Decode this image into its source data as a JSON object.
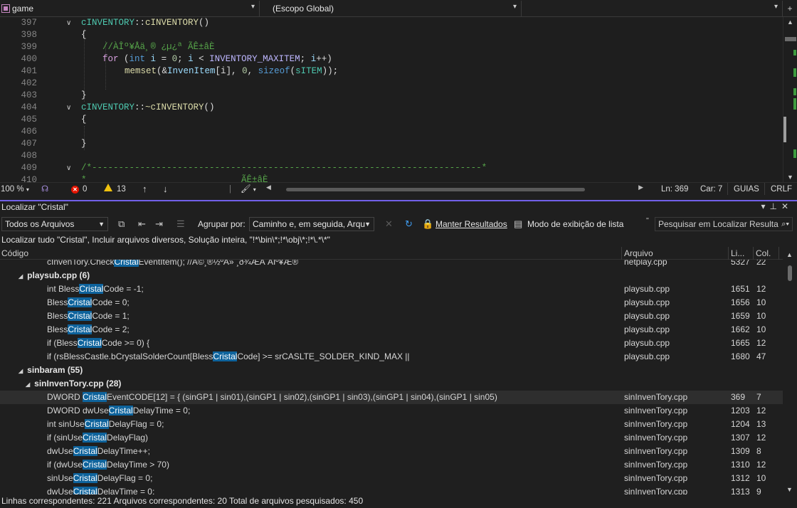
{
  "navbar": {
    "project": "game",
    "scope": "(Escopo Global)",
    "member": ""
  },
  "editor": {
    "lines": [
      {
        "n": "397",
        "fold": true
      },
      {
        "n": "398",
        "fold": false
      },
      {
        "n": "399",
        "fold": false
      },
      {
        "n": "400",
        "fold": false
      },
      {
        "n": "401",
        "fold": false
      },
      {
        "n": "402",
        "fold": false
      },
      {
        "n": "403",
        "fold": false
      },
      {
        "n": "404",
        "fold": true
      },
      {
        "n": "405",
        "fold": false
      },
      {
        "n": "406",
        "fold": false
      },
      {
        "n": "407",
        "fold": false
      },
      {
        "n": "408",
        "fold": false
      },
      {
        "n": "409",
        "fold": true
      },
      {
        "n": "410",
        "fold": false
      }
    ],
    "code": {
      "l397_class": "cINVENTORY",
      "l397_sep": "::",
      "l397_fn": "cINVENTORY",
      "l397_paren": "()",
      "l398": "{",
      "l399": "//ÀÎº¥Åä¸® ¿µ¿ª ÃÊ±âÈ",
      "l400_for": "for",
      "l400_open": " (",
      "l400_int": "int",
      "l400_i": " i",
      "l400_eq": " = ",
      "l400_zero": "0",
      "l400_semi": "; ",
      "l400_i2": "i",
      "l400_lt": " < ",
      "l400_max": "INVENTORY_MAXITEM",
      "l400_semi2": "; ",
      "l400_i3": "i",
      "l400_inc": "++)",
      "l401_fn": "memset",
      "l401_open": "(&",
      "l401_arr": "InvenItem",
      "l401_idx": "[i], ",
      "l401_zero": "0",
      "l401_comma": ", ",
      "l401_sizeof": "sizeof",
      "l401_po": "(",
      "l401_type": "sITEM",
      "l401_end": "));",
      "l403": "}",
      "l404_class": "cINVENTORY",
      "l404_sep": "::",
      "l404_fn": "~cINVENTORY",
      "l404_paren": "()",
      "l405": "{",
      "l407": "}",
      "l409": "/*-------------------------------------------------------------------------*",
      "l410": "*                             ÃÊ±âÈ"
    }
  },
  "edstatus": {
    "zoom": "100 %",
    "errors": "0",
    "warnings": "13",
    "line": "Ln: 369",
    "char": "Car: 7",
    "tabs": "GUIAS",
    "eol": "CRLF"
  },
  "find": {
    "title": "Localizar \"Cristal\"",
    "scope_combo": "Todos os Arquivos",
    "group_label": "Agrupar por:",
    "group_combo": "Caminho e, em seguida, Arqu",
    "keep_results": "Manter Resultados",
    "list_mode": "Modo de exibição de lista",
    "search_placeholder": "Pesquisar em Localizar Resulta",
    "description": "Localizar tudo \"Cristal\", Incluir arquivos diversos, Solução inteira, \"!*\\bin\\*;!*\\obj\\*;!*\\.*\\*\"",
    "columns": {
      "code": "Código",
      "file": "Arquivo",
      "line": "Li...",
      "col": "Col."
    },
    "status": "Linhas correspondentes: 221 Arquivos correspondentes: 20 Total de arquivos pesquisados: 450"
  },
  "results": [
    {
      "type": "row",
      "pre": "cInvenTory.Check",
      "hit": "Cristal",
      "post": "EventItem(); //À©¸®½ºÅ» ¸ð¾ÆÁ ÀÌº¥Æ®",
      "file": "netplay.cpp",
      "line": "5327",
      "col": "22"
    },
    {
      "type": "group",
      "indent": 0,
      "label": "playsub.cpp",
      "count": "(6)"
    },
    {
      "type": "row",
      "pre": "int Bless",
      "hit": "Cristal",
      "post": "Code = -1;",
      "file": "playsub.cpp",
      "line": "1651",
      "col": "12"
    },
    {
      "type": "row",
      "pre": "Bless",
      "hit": "Cristal",
      "post": "Code = 0;",
      "file": "playsub.cpp",
      "line": "1656",
      "col": "10"
    },
    {
      "type": "row",
      "pre": "Bless",
      "hit": "Cristal",
      "post": "Code = 1;",
      "file": "playsub.cpp",
      "line": "1659",
      "col": "10"
    },
    {
      "type": "row",
      "pre": "Bless",
      "hit": "Cristal",
      "post": "Code = 2;",
      "file": "playsub.cpp",
      "line": "1662",
      "col": "10"
    },
    {
      "type": "row",
      "pre": "if (Bless",
      "hit": "Cristal",
      "post": "Code >= 0) {",
      "file": "playsub.cpp",
      "line": "1665",
      "col": "12"
    },
    {
      "type": "row",
      "pre": "if (rsBlessCastle.bCrystalSolderCount[Bless",
      "hit": "Cristal",
      "post": "Code] >= srCASLTE_SOLDER_KIND_MAX ||",
      "file": "playsub.cpp",
      "line": "1680",
      "col": "47"
    },
    {
      "type": "group",
      "indent": 0,
      "label": "sinbaram",
      "count": "(55)"
    },
    {
      "type": "group",
      "indent": 1,
      "label": "sinInvenTory.cpp",
      "count": "(28)"
    },
    {
      "type": "row",
      "selected": true,
      "pre": "DWORD ",
      "hit": "Cristal",
      "post": "EventCODE[12] = { (sinGP1 | sin01),(sinGP1 | sin02),(sinGP1 | sin03),(sinGP1 | sin04),(sinGP1 | sin05)",
      "file": "sinInvenTory.cpp",
      "line": "369",
      "col": "7"
    },
    {
      "type": "row",
      "pre": "DWORD dwUse",
      "hit": "Cristal",
      "post": "DelayTime = 0;",
      "file": "sinInvenTory.cpp",
      "line": "1203",
      "col": "12"
    },
    {
      "type": "row",
      "pre": "int   sinUse",
      "hit": "Cristal",
      "post": "DelayFlag = 0;",
      "file": "sinInvenTory.cpp",
      "line": "1204",
      "col": "13"
    },
    {
      "type": "row",
      "pre": "if (sinUse",
      "hit": "Cristal",
      "post": "DelayFlag)",
      "file": "sinInvenTory.cpp",
      "line": "1307",
      "col": "12"
    },
    {
      "type": "row",
      "pre": "dwUse",
      "hit": "Cristal",
      "post": "DelayTime++;",
      "file": "sinInvenTory.cpp",
      "line": "1309",
      "col": "8"
    },
    {
      "type": "row",
      "pre": "if (dwUse",
      "hit": "Cristal",
      "post": "DelayTime > 70)",
      "file": "sinInvenTory.cpp",
      "line": "1310",
      "col": "12"
    },
    {
      "type": "row",
      "pre": "sinUse",
      "hit": "Cristal",
      "post": "DelayFlag = 0;",
      "file": "sinInvenTory.cpp",
      "line": "1312",
      "col": "10"
    },
    {
      "type": "row",
      "pre": "dwUse",
      "hit": "Cristal",
      "post": "DelayTime = 0;",
      "file": "sinInvenTory.cpp",
      "line": "1313",
      "col": "9"
    }
  ]
}
